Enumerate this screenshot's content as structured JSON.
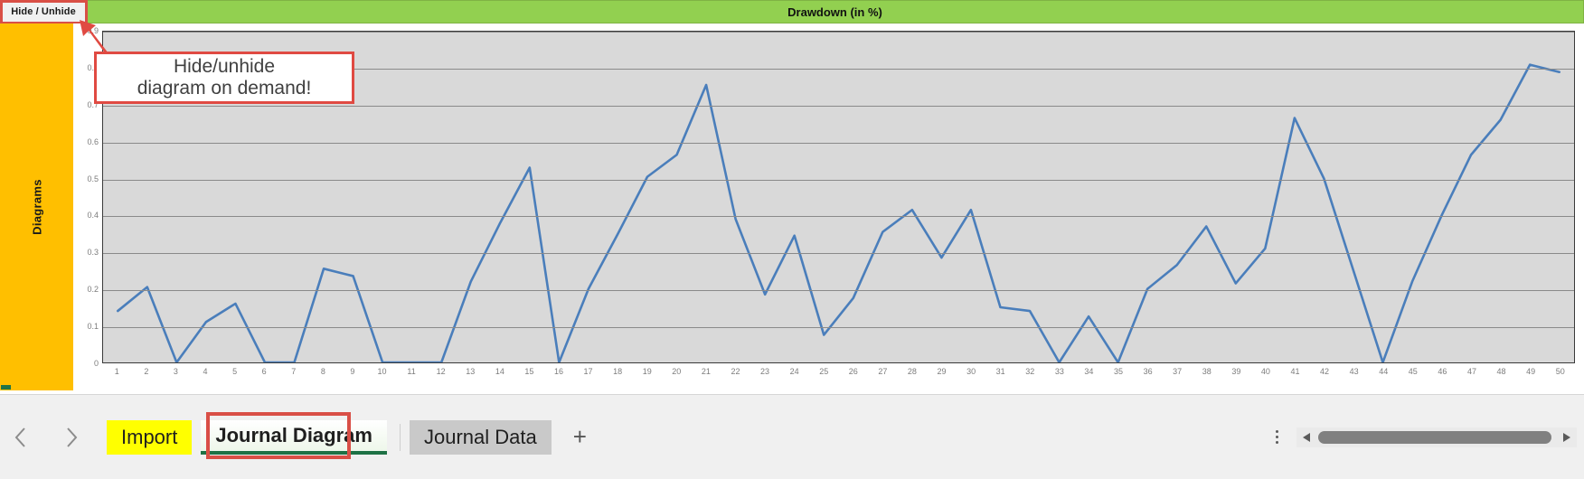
{
  "topbar": {
    "hide_unhide_label": "Hide / Unhide",
    "title": "Drawdown (in %)",
    "title_bg": "#92d050",
    "highlight_color": "#d94f46"
  },
  "sidebar": {
    "label": "Diagrams",
    "bg": "#ffbf00"
  },
  "callout": {
    "line1": "Hide/unhide",
    "line2": "diagram on demand!",
    "border_color": "#e04a42"
  },
  "sheetbar": {
    "prev_label": "‹",
    "next_label": "›",
    "add_label": "+",
    "scroll_left": "◀",
    "scroll_right": "▶",
    "tabs": [
      {
        "label": "Import",
        "state": "highlight-yellow"
      },
      {
        "label": "Journal Diagram",
        "state": "active"
      },
      {
        "label": "Journal Data",
        "state": "normal"
      }
    ]
  },
  "chart_data": {
    "type": "line",
    "title": "Drawdown (in %)",
    "xlabel": "",
    "ylabel": "",
    "ylim": [
      0,
      0.9
    ],
    "xlim": [
      1,
      50
    ],
    "grid": true,
    "legend": "none",
    "line_color": "#4a7ebb",
    "plot_bg": "#d9d9d9",
    "ytick_labels": [
      "0",
      "0.1",
      "0.2",
      "0.3",
      "0.4",
      "0.5",
      "0.6",
      "0.7",
      "0.8",
      "0.9"
    ],
    "ytick_values": [
      0,
      0.1,
      0.2,
      0.3,
      0.4,
      0.5,
      0.6,
      0.7,
      0.8,
      0.9
    ],
    "categories": [
      1,
      2,
      3,
      4,
      5,
      6,
      7,
      8,
      9,
      10,
      11,
      12,
      13,
      14,
      15,
      16,
      17,
      18,
      19,
      20,
      21,
      22,
      23,
      24,
      25,
      26,
      27,
      28,
      29,
      30,
      31,
      32,
      33,
      34,
      35,
      36,
      37,
      38,
      39,
      40,
      41,
      42,
      43,
      44,
      45,
      46,
      47,
      48,
      49,
      50
    ],
    "values": [
      0.14,
      0.205,
      0.0,
      0.11,
      0.16,
      0.0,
      0.0,
      0.255,
      0.235,
      0.0,
      0.0,
      0.0,
      0.22,
      0.38,
      0.53,
      0.0,
      0.2,
      0.35,
      0.505,
      0.565,
      0.755,
      0.39,
      0.185,
      0.345,
      0.075,
      0.175,
      0.355,
      0.415,
      0.285,
      0.415,
      0.15,
      0.14,
      0.0,
      0.125,
      0.0,
      0.2,
      0.265,
      0.37,
      0.215,
      0.31,
      0.665,
      0.5,
      0.25,
      0.0,
      0.22,
      0.4,
      0.565,
      0.66,
      0.81,
      0.79
    ]
  }
}
